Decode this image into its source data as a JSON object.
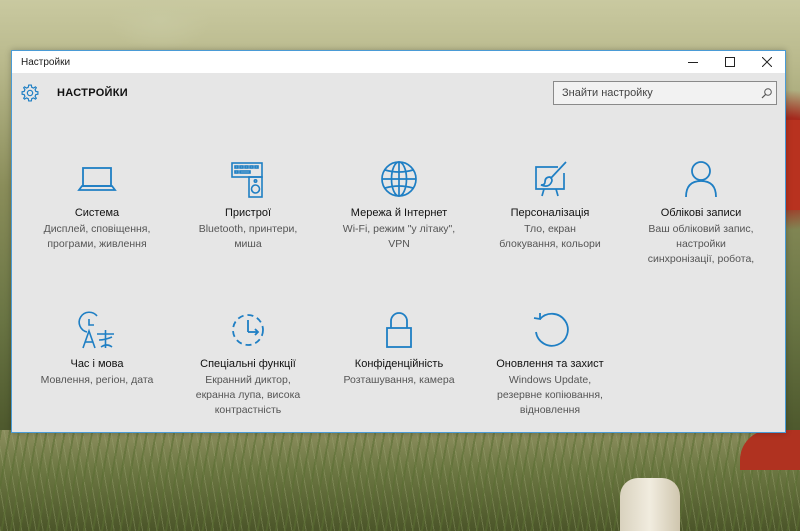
{
  "window": {
    "title": "Настройки",
    "controls": {
      "minimize": "—",
      "maximize": "☐",
      "close": "✕"
    }
  },
  "header": {
    "icon": "gear-icon",
    "title": "НАСТРОЙКИ",
    "search_placeholder": "Знайти настройку"
  },
  "accent_color": "#1f7fc4",
  "categories": [
    {
      "icon": "laptop-icon",
      "label": "Система",
      "desc": "Дисплей, сповіщення,\nпрограми, живлення"
    },
    {
      "icon": "devices-icon",
      "label": "Пристрої",
      "desc": "Bluetooth, принтери,\nмиша"
    },
    {
      "icon": "globe-icon",
      "label": "Мережа й Інтернет",
      "desc": "Wi-Fi, режим \"у літаку\",\nVPN"
    },
    {
      "icon": "paint-icon",
      "label": "Персоналізація",
      "desc": "Тло, екран\nблокування, кольори"
    },
    {
      "icon": "person-icon",
      "label": "Облікові записи",
      "desc": "Ваш обліковий запис,\nнастройки\nсинхронізації, робота,"
    },
    {
      "icon": "time-language-icon",
      "label": "Час і мова",
      "desc": "Мовлення, регіон, дата"
    },
    {
      "icon": "ease-of-access-icon",
      "label": "Спеціальні функції",
      "desc": "Екранний диктор,\nекранна лупа, висока\nконтрастність"
    },
    {
      "icon": "lock-icon",
      "label": "Конфіденційність",
      "desc": "Розташування, камера"
    },
    {
      "icon": "update-icon",
      "label": "Оновлення та захист",
      "desc": "Windows Update,\nрезервне копіювання,\nвідновлення"
    }
  ]
}
